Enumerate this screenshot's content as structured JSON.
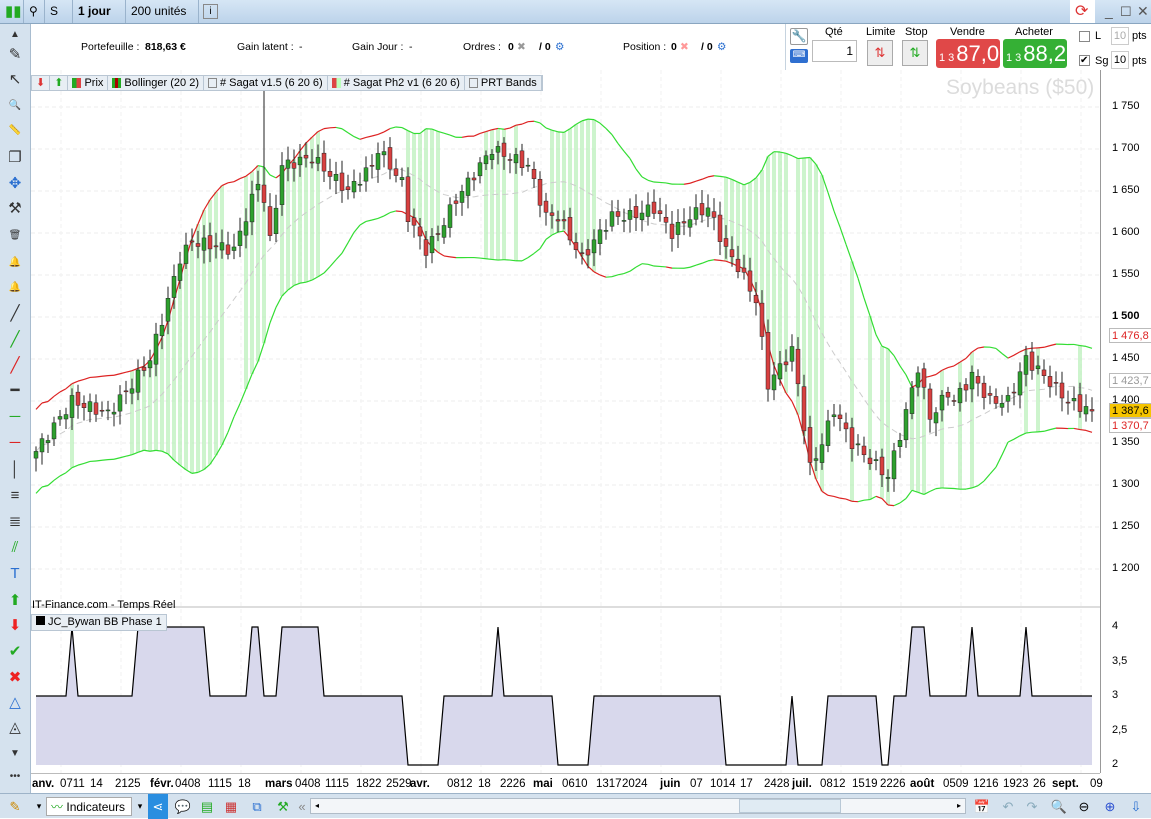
{
  "toolbar": {
    "symbol": "S",
    "period": "1 jour",
    "units": "200 unités",
    "info_icon": "i"
  },
  "info": {
    "portfolio_label": "Portefeuille :",
    "portfolio_value": "818,63 €",
    "latent_label": "Gain latent :",
    "latent_value": "-",
    "day_label": "Gain Jour :",
    "day_value": "-",
    "orders_label": "Ordres :",
    "orders_value": "0",
    "orders_total": "/ 0",
    "position_label": "Position :",
    "position_value": "0",
    "position_total": "/ 0"
  },
  "trade": {
    "qty_label": "Qté",
    "qty_value": "1",
    "limit_label": "Limite",
    "stop_label": "Stop",
    "sell_label": "Vendre",
    "sell_prefix": "1 3",
    "sell_price": "87,0",
    "buy_label": "Acheter",
    "buy_prefix": "1 3",
    "buy_price": "88,2",
    "l_label": "L",
    "l_value": "10",
    "l_checked": false,
    "sg_label": "Sg",
    "sg_value": "10",
    "sg_checked": true,
    "pts": "pts"
  },
  "legend": [
    "Prix",
    "Bollinger (20 2)",
    "# Sagat v1.5 (6 20 6)",
    "# Sagat Ph2 v1 (6 20 6)",
    "PRT Bands"
  ],
  "instrument": "Soybeans ($50)",
  "source": "IT-Finance.com - Temps Réel",
  "indicator_name": "JC_Bywan BB Phase 1",
  "colors": {
    "up": "#2ea02e",
    "down": "#d84040",
    "band_green": "#33dd33",
    "band_red": "#dd2222",
    "shade": "#b8f0b8",
    "indicator_fill": "#d8d8ec",
    "sell": "#e04848",
    "buy": "#35b035",
    "last": "#f5c400"
  },
  "chart_data": {
    "type": "candlestick",
    "title": "Soybeans ($50)",
    "y_ticks": [
      "1 750",
      "1 700",
      "1 650",
      "1 600",
      "1 550",
      "1 500",
      "1 450",
      "1 400",
      "1 350",
      "1 300",
      "1 250",
      "1 200"
    ],
    "y_tick_values": [
      1750,
      1700,
      1650,
      1600,
      1550,
      1500,
      1450,
      1400,
      1350,
      1300,
      1250,
      1200
    ],
    "ylim": [
      1160,
      1790
    ],
    "close_keypoints": [
      [
        0,
        1340
      ],
      [
        6,
        1400
      ],
      [
        12,
        1385
      ],
      [
        16,
        1420
      ],
      [
        19,
        1450
      ],
      [
        22,
        1520
      ],
      [
        24,
        1570
      ],
      [
        26,
        1590
      ],
      [
        33,
        1580
      ],
      [
        35,
        1620
      ],
      [
        37,
        1660
      ],
      [
        38,
        1640
      ],
      [
        39,
        1590
      ],
      [
        41,
        1680
      ],
      [
        46,
        1690
      ],
      [
        49,
        1670
      ],
      [
        52,
        1650
      ],
      [
        56,
        1680
      ],
      [
        57,
        1700
      ],
      [
        61,
        1660
      ],
      [
        62,
        1620
      ],
      [
        65,
        1580
      ],
      [
        67,
        1600
      ],
      [
        70,
        1640
      ],
      [
        72,
        1660
      ],
      [
        76,
        1700
      ],
      [
        79,
        1690
      ],
      [
        82,
        1680
      ],
      [
        85,
        1620
      ],
      [
        87,
        1620
      ],
      [
        91,
        1570
      ],
      [
        93,
        1590
      ],
      [
        96,
        1620
      ],
      [
        99,
        1620
      ],
      [
        103,
        1630
      ],
      [
        106,
        1600
      ],
      [
        109,
        1620
      ],
      [
        112,
        1630
      ],
      [
        115,
        1580
      ],
      [
        117,
        1560
      ],
      [
        120,
        1520
      ],
      [
        122,
        1420
      ],
      [
        126,
        1460
      ],
      [
        127,
        1420
      ],
      [
        129,
        1320
      ],
      [
        131,
        1350
      ],
      [
        133,
        1390
      ],
      [
        136,
        1350
      ],
      [
        139,
        1330
      ],
      [
        142,
        1310
      ],
      [
        144,
        1360
      ],
      [
        147,
        1440
      ],
      [
        149,
        1380
      ],
      [
        152,
        1410
      ],
      [
        153,
        1400
      ],
      [
        156,
        1430
      ],
      [
        159,
        1400
      ],
      [
        162,
        1400
      ],
      [
        165,
        1450
      ],
      [
        168,
        1430
      ],
      [
        172,
        1400
      ],
      [
        176,
        1388
      ]
    ],
    "bollinger": {
      "period": 20,
      "k": 2
    },
    "price_badges": [
      {
        "label": "1 476,8",
        "type": "upper"
      },
      {
        "label": "1 423,7",
        "type": "mid"
      },
      {
        "label": "1 387,6",
        "type": "last"
      },
      {
        "label": "1 370,7",
        "type": "lower"
      }
    ],
    "indicator": {
      "name": "JC_Bywan BB Phase 1",
      "ylim": [
        2,
        4
      ],
      "y_ticks": [
        "4",
        "3,5",
        "3",
        "2,5",
        "2"
      ],
      "y_tick_values": [
        4,
        3.5,
        3,
        2.5,
        2
      ]
    },
    "x_labels": [
      {
        "t": "anv.",
        "b": true
      },
      {
        "t": "0711"
      },
      {
        "t": "14"
      },
      {
        "t": "2125"
      },
      {
        "t": "févr.",
        "b": true
      },
      {
        "t": "0408"
      },
      {
        "t": "1115"
      },
      {
        "t": "18"
      },
      {
        "t": "mars",
        "b": true
      },
      {
        "t": "0408"
      },
      {
        "t": "1115"
      },
      {
        "t": "1822"
      },
      {
        "t": "2529"
      },
      {
        "t": "avr.",
        "b": true
      },
      {
        "t": "0812"
      },
      {
        "t": "18"
      },
      {
        "t": "2226"
      },
      {
        "t": "mai",
        "b": true
      },
      {
        "t": "0610"
      },
      {
        "t": "1317"
      },
      {
        "t": "2024"
      },
      {
        "t": "juin",
        "b": true
      },
      {
        "t": "07"
      },
      {
        "t": "1014"
      },
      {
        "t": "17"
      },
      {
        "t": "2428"
      },
      {
        "t": "juil.",
        "b": true
      },
      {
        "t": "0812"
      },
      {
        "t": "1519"
      },
      {
        "t": "2226"
      },
      {
        "t": "août",
        "b": true
      },
      {
        "t": "0509"
      },
      {
        "t": "1216"
      },
      {
        "t": "1923"
      },
      {
        "t": "26"
      },
      {
        "t": "sept.",
        "b": true
      },
      {
        "t": "09"
      }
    ]
  },
  "bottom": {
    "indicators_label": "Indicateurs"
  }
}
